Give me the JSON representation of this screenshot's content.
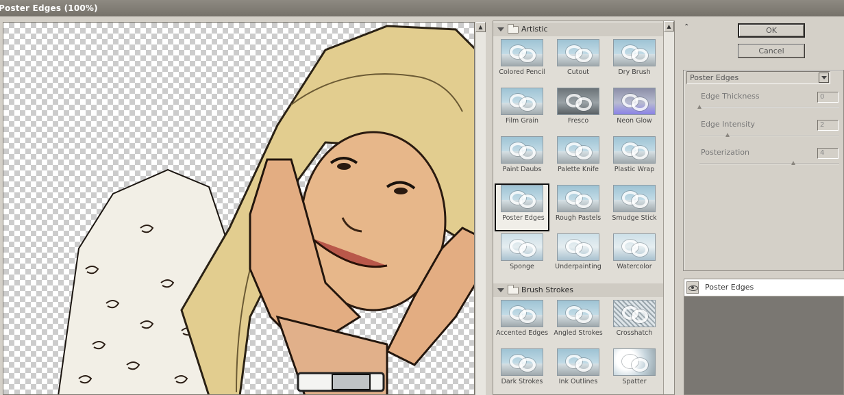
{
  "window": {
    "title": "Poster Edges (100%)"
  },
  "colors": {
    "accent": "#2a2826",
    "panel": "#d4d0c8",
    "checker": "#cccccc"
  },
  "preview": {
    "image": "cartoon-filtered-portrait",
    "icons": {
      "scroll_up": "arrow-up-icon"
    }
  },
  "gallery": {
    "categories": [
      {
        "name": "Artistic",
        "filters": [
          "Colored Pencil",
          "Cutout",
          "Dry Brush",
          "Film Grain",
          "Fresco",
          "Neon Glow",
          "Paint Daubs",
          "Palette Knife",
          "Plastic Wrap",
          "Poster Edges",
          "Rough Pastels",
          "Smudge Stick",
          "Sponge",
          "Underpainting",
          "Watercolor"
        ]
      },
      {
        "name": "Brush Strokes",
        "filters": [
          "Accented Edges",
          "Angled Strokes",
          "Crosshatch",
          "Dark Strokes",
          "Ink Outlines",
          "Spatter"
        ]
      }
    ],
    "selected": "Poster Edges"
  },
  "buttons": {
    "ok": "OK",
    "cancel": "Cancel"
  },
  "settings": {
    "filter": "Poster Edges",
    "params": [
      {
        "label": "Edge Thickness",
        "value": "0",
        "fraction": 0.0
      },
      {
        "label": "Edge Intensity",
        "value": "2",
        "fraction": 0.2
      },
      {
        "label": "Posterization",
        "value": "4",
        "fraction": 0.67
      }
    ]
  },
  "layers": {
    "items": [
      {
        "name": "Poster Edges"
      }
    ]
  }
}
